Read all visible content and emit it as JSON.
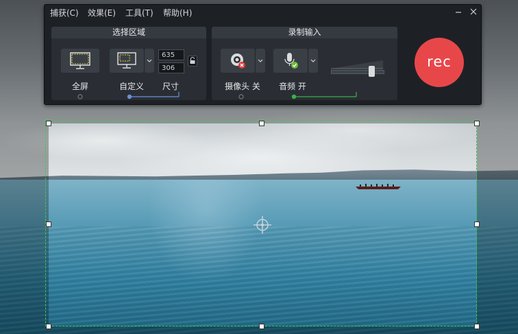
{
  "menubar": {
    "items": [
      "捕获(C)",
      "效果(E)",
      "工具(T)",
      "帮助(H)"
    ]
  },
  "select_area": {
    "title": "选择区域",
    "fullscreen_label": "全屏",
    "custom_label": "自定义",
    "size_label": "尺寸",
    "width_value": "635",
    "height_value": "306"
  },
  "record_input": {
    "title": "录制输入",
    "camera_label": "摄像头 关",
    "audio_label": "音频 开",
    "audio_level": 0.8
  },
  "rec_button": {
    "label": "rec"
  },
  "colors": {
    "accent_blue": "#6b8fd6",
    "accent_green": "#3cb04a",
    "rec_red": "#e8474a",
    "selection_dash": "#2fd04a"
  }
}
